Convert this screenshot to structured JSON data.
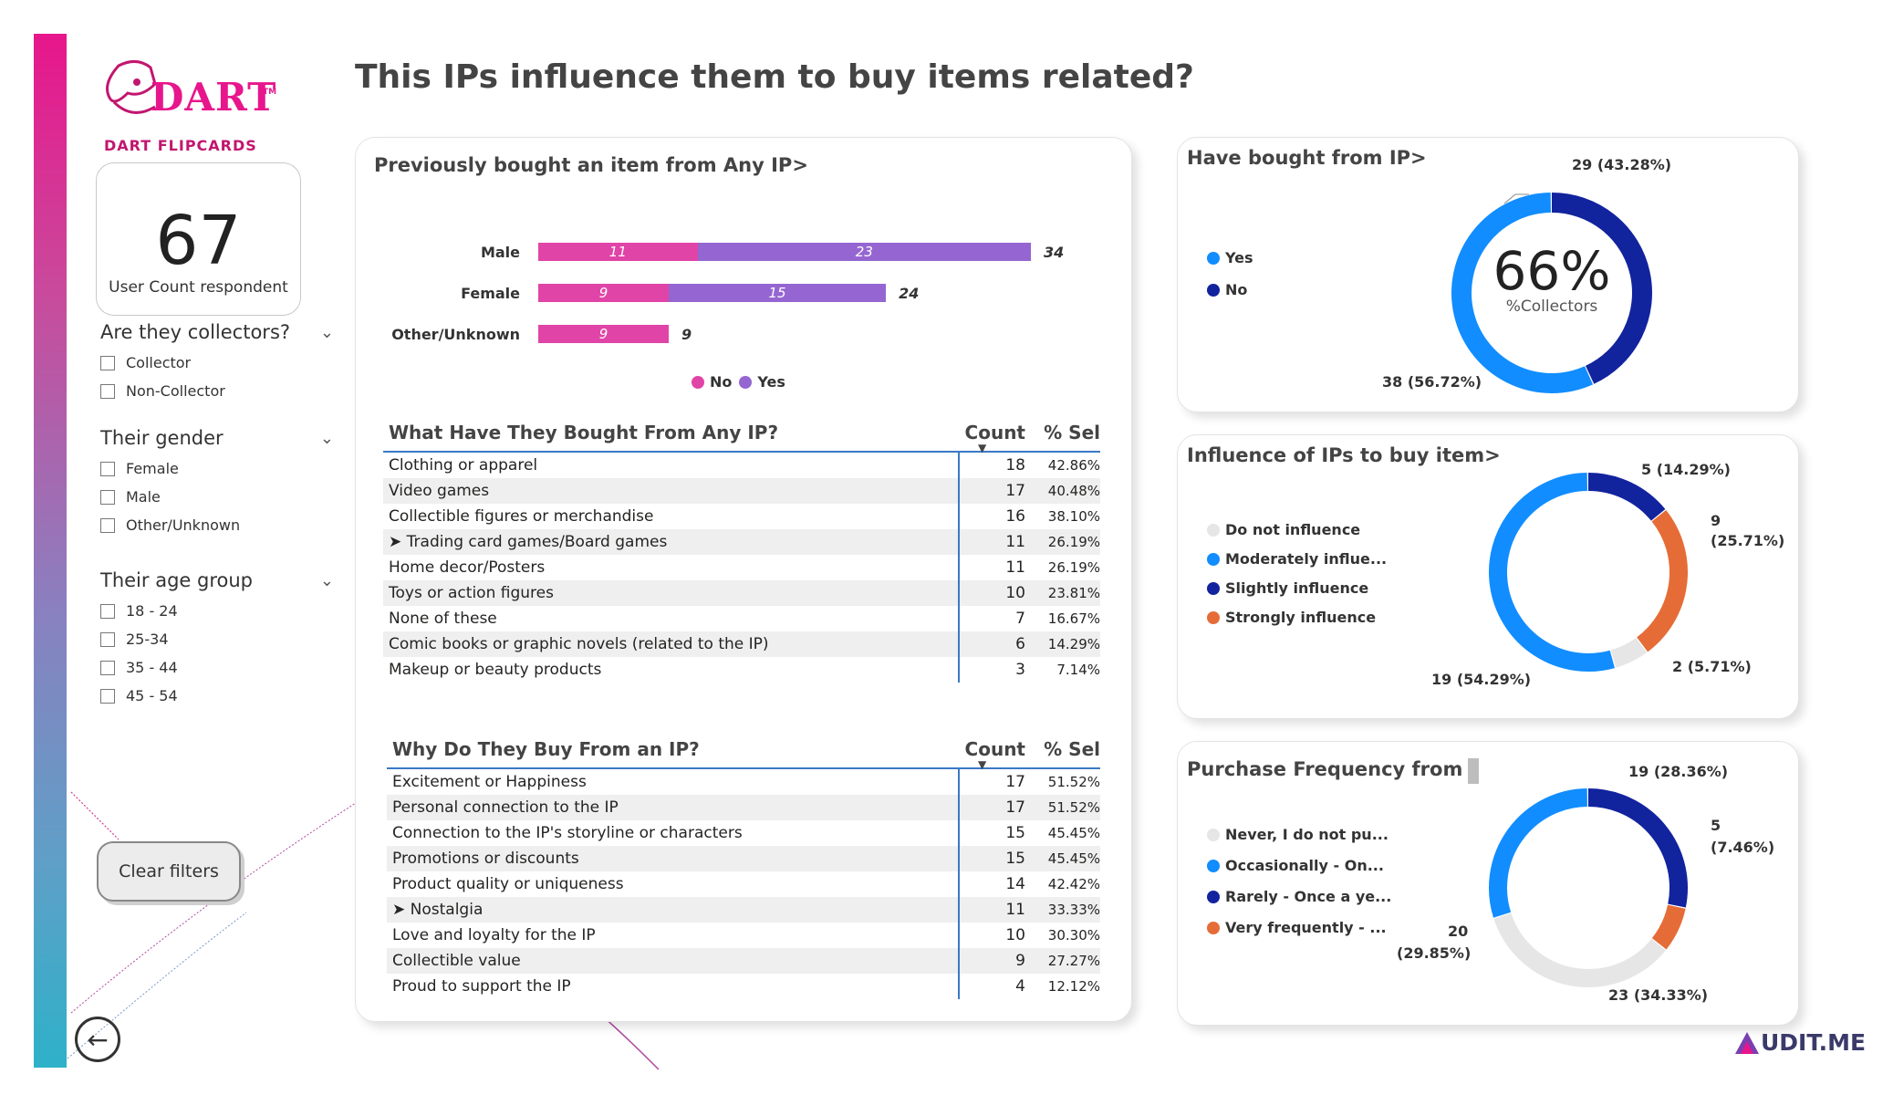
{
  "page_title": "This IPs influence them to buy items related?",
  "logo": {
    "brand": "DART",
    "sub": "DART FLIPCARDS",
    "tm": "TM"
  },
  "kpi": {
    "value": "67",
    "label": "User Count respondent"
  },
  "slicers": [
    {
      "title": "Are they collectors?",
      "options": [
        "Collector",
        "Non-Collector"
      ]
    },
    {
      "title": "Their gender",
      "options": [
        "Female",
        "Male",
        "Other/Unknown"
      ]
    },
    {
      "title": "Their age group",
      "options": [
        "18 - 24",
        "25-34",
        "35 - 44",
        "45 - 54"
      ]
    }
  ],
  "clear_filters": "Clear filters",
  "bar_card": {
    "title": "Previously bought an item from Any IP>",
    "colors": {
      "No": "#e044a7",
      "Yes": "#9566d2"
    },
    "rows": [
      {
        "label": "Male",
        "no": 11,
        "yes": 23,
        "total": 34
      },
      {
        "label": "Female",
        "no": 9,
        "yes": 15,
        "total": 24
      },
      {
        "label": "Other/Unknown",
        "no": 9,
        "yes": 0,
        "total": 9
      }
    ],
    "legend": [
      "No",
      "Yes"
    ],
    "max": 34
  },
  "table1": {
    "header": {
      "name": "What Have They Bought From Any IP?",
      "count": "Count",
      "pct": "% Sel"
    },
    "rows": [
      {
        "name": "Clothing or apparel",
        "count": "18",
        "pct": "42.86%"
      },
      {
        "name": "Video games",
        "count": "17",
        "pct": "40.48%"
      },
      {
        "name": "Collectible figures or merchandise",
        "count": "16",
        "pct": "38.10%"
      },
      {
        "name": "➤ Trading card games/Board games",
        "count": "11",
        "pct": "26.19%"
      },
      {
        "name": "Home decor/Posters",
        "count": "11",
        "pct": "26.19%"
      },
      {
        "name": "Toys or action figures",
        "count": "10",
        "pct": "23.81%"
      },
      {
        "name": "None of these",
        "count": "7",
        "pct": "16.67%"
      },
      {
        "name": "Comic books or graphic novels (related to the IP)",
        "count": "6",
        "pct": "14.29%"
      },
      {
        "name": "Makeup or beauty products",
        "count": "3",
        "pct": "7.14%"
      }
    ]
  },
  "table2": {
    "header": {
      "name": "Why Do They Buy From an IP?",
      "count": "Count",
      "pct": "% Sel"
    },
    "rows": [
      {
        "name": "Excitement or Happiness",
        "count": "17",
        "pct": "51.52%"
      },
      {
        "name": "Personal connection to the IP",
        "count": "17",
        "pct": "51.52%"
      },
      {
        "name": "Connection to the IP's storyline or characters",
        "count": "15",
        "pct": "45.45%"
      },
      {
        "name": "Promotions or discounts",
        "count": "15",
        "pct": "45.45%"
      },
      {
        "name": "Product quality or uniqueness",
        "count": "14",
        "pct": "42.42%"
      },
      {
        "name": "➤ Nostalgia",
        "count": "11",
        "pct": "33.33%"
      },
      {
        "name": "Love and loyalty for the IP",
        "count": "10",
        "pct": "30.30%"
      },
      {
        "name": "Collectible value",
        "count": "9",
        "pct": "27.27%"
      },
      {
        "name": "Proud to support the IP",
        "count": "4",
        "pct": "12.12%"
      }
    ]
  },
  "donut1": {
    "title": "Have bought from IP>",
    "center_value": "66%",
    "center_label": "%Collectors",
    "legend": [
      {
        "name": "Yes",
        "color": "#118dff"
      },
      {
        "name": "No",
        "color": "#12239e"
      }
    ],
    "labels": {
      "top": "29 (43.28%)",
      "bottom": "38 (56.72%)"
    }
  },
  "donut2": {
    "title": "Influence of IPs to buy item>",
    "legend": [
      {
        "name": "Do not influence",
        "color": "#e6e6e6"
      },
      {
        "name": "Moderately influe...",
        "color": "#118dff"
      },
      {
        "name": "Slightly influence",
        "color": "#12239e"
      },
      {
        "name": "Strongly influence",
        "color": "#e66c37"
      }
    ],
    "labels": {
      "a": "5 (14.29%)",
      "b1": "9",
      "b2": "(25.71%)",
      "c": "2 (5.71%)",
      "d": "19 (54.29%)"
    }
  },
  "donut3": {
    "title": "Purchase Frequency from",
    "legend": [
      {
        "name": "Never, I do not pu...",
        "color": "#e6e6e6"
      },
      {
        "name": "Occasionally - On...",
        "color": "#118dff"
      },
      {
        "name": "Rarely - Once a ye...",
        "color": "#12239e"
      },
      {
        "name": "Very frequently - ...",
        "color": "#e66c37"
      }
    ],
    "labels": {
      "a": "19 (28.36%)",
      "b1": "5",
      "b2": "(7.46%)",
      "c1": "20",
      "c2": "(29.85%)",
      "d": "23 (34.33%)"
    }
  },
  "chart_data": [
    {
      "type": "bar",
      "title": "Previously bought an item from Any IP>",
      "categories": [
        "Male",
        "Female",
        "Other/Unknown"
      ],
      "series": [
        {
          "name": "No",
          "values": [
            11,
            9,
            9
          ]
        },
        {
          "name": "Yes",
          "values": [
            23,
            15,
            0
          ]
        }
      ]
    },
    {
      "type": "pie",
      "title": "Have bought from IP>",
      "categories": [
        "Yes",
        "No"
      ],
      "values": [
        38,
        29
      ]
    },
    {
      "type": "pie",
      "title": "Influence of IPs to buy item>",
      "categories": [
        "Slightly influence",
        "Strongly influence",
        "Do not influence",
        "Moderately influe..."
      ],
      "values": [
        5,
        9,
        2,
        19
      ]
    },
    {
      "type": "pie",
      "title": "Purchase Frequency from",
      "categories": [
        "Rarely - Once a ye...",
        "Very frequently - ...",
        "Never, I do not pu...",
        "Occasionally - On..."
      ],
      "values": [
        19,
        5,
        23,
        20
      ]
    }
  ],
  "footer_brand": "UDIT.ME"
}
